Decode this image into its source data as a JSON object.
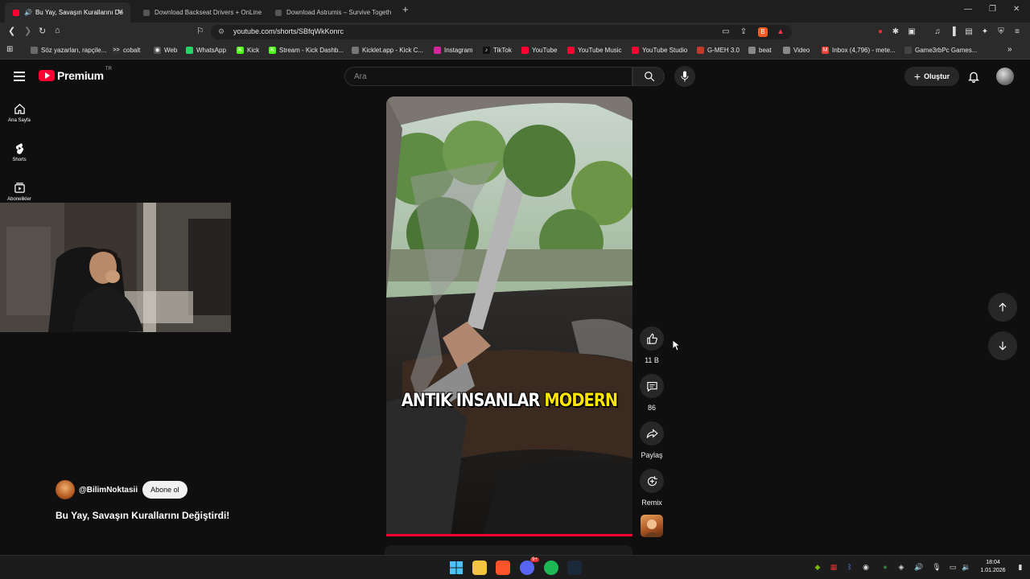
{
  "tabs": [
    {
      "title": "Bu Yay, Savaşın Kurallarını De",
      "active": true
    },
    {
      "title": "Download Backseat Drivers + OnLine",
      "active": false
    },
    {
      "title": "Download Astrumis – Survive Togeth",
      "active": false
    }
  ],
  "new_tab_label": "+",
  "window_controls": {
    "minimize": "—",
    "restore": "❐",
    "close": "✕"
  },
  "address": {
    "url": "youtube.com/shorts/SBfqWkKonrc"
  },
  "bookmarks": [
    {
      "label": "Söz yazarları, rapçile...",
      "color": "#6a6a6a",
      "glyph": ""
    },
    {
      "label": "cobalt",
      "color": "#333333",
      "glyph": ">>"
    },
    {
      "label": "Web",
      "color": "#555555",
      "glyph": "◉"
    },
    {
      "label": "WhatsApp",
      "color": "#25d366",
      "glyph": ""
    },
    {
      "label": "Kick",
      "color": "#53fc18",
      "glyph": "K"
    },
    {
      "label": "Stream - Kick Dashb...",
      "color": "#53fc18",
      "glyph": "K"
    },
    {
      "label": "Kicklet.app - Kick C...",
      "color": "#777777",
      "glyph": ""
    },
    {
      "label": "Instagram",
      "color": "#d6249f",
      "glyph": ""
    },
    {
      "label": "TikTok",
      "color": "#111111",
      "glyph": "♪"
    },
    {
      "label": "YouTube",
      "color": "#ff0033",
      "glyph": ""
    },
    {
      "label": "YouTube Music",
      "color": "#ff0033",
      "glyph": ""
    },
    {
      "label": "YouTube Studio",
      "color": "#ff0033",
      "glyph": ""
    },
    {
      "label": "G-MEH 3.0",
      "color": "#c0392b",
      "glyph": ""
    },
    {
      "label": "beat",
      "color": "#888888",
      "glyph": ""
    },
    {
      "label": "Video",
      "color": "#888888",
      "glyph": ""
    },
    {
      "label": "Inbox (4,796) - mete...",
      "color": "#ea4335",
      "glyph": "M"
    },
    {
      "label": "Game3rbPc Games...",
      "color": "#444444",
      "glyph": ""
    }
  ],
  "youtube": {
    "brand": "Premium",
    "region": "TR",
    "search_placeholder": "Ara",
    "create_label": "Oluştur",
    "sidebar": [
      {
        "label": "Ana Sayfa",
        "icon": "home-icon"
      },
      {
        "label": "Shorts",
        "icon": "shorts-icon"
      },
      {
        "label": "Abonelikler",
        "icon": "subscriptions-icon"
      }
    ],
    "short": {
      "caption_white": "ANTIK INSANLAR ",
      "caption_yellow": "MODERN",
      "channel": "@BilimNoktasii",
      "subscribe_label": "Abone ol",
      "title": "Bu Yay, Savaşın Kurallarını Değiştirdi!",
      "actions": [
        {
          "name": "like",
          "label": "11 B"
        },
        {
          "name": "comment",
          "label": "86"
        },
        {
          "name": "share",
          "label": "Paylaş"
        },
        {
          "name": "remix",
          "label": "Remix"
        }
      ]
    }
  },
  "taskbar": {
    "time": "18:04",
    "date": "1.01.2026",
    "discord_badge": "9+"
  },
  "colors": {
    "accent": "#ff0033",
    "caption_highlight": "#ffe600",
    "background": "#0f0f0f"
  }
}
